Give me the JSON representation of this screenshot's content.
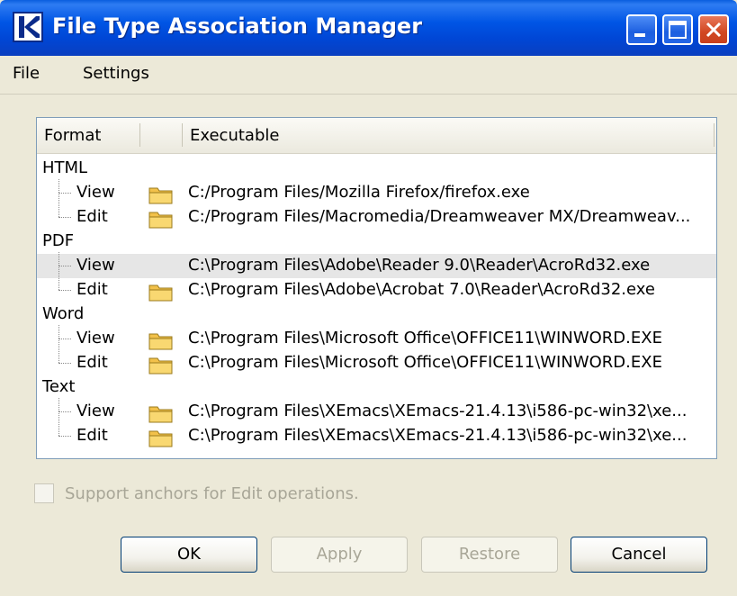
{
  "window": {
    "title": "File Type Association Manager"
  },
  "menu": {
    "items": [
      {
        "label": "File"
      },
      {
        "label": "Settings"
      }
    ]
  },
  "table": {
    "columns": [
      "Format",
      "",
      "Executable"
    ],
    "groups": [
      {
        "name": "HTML",
        "entries": [
          {
            "action": "View",
            "path": "C:/Program Files/Mozilla Firefox/firefox.exe",
            "has_icon": true
          },
          {
            "action": "Edit",
            "path": "C:/Program Files/Macromedia/Dreamweaver MX/Dreamweav...",
            "has_icon": true
          }
        ]
      },
      {
        "name": "PDF",
        "entries": [
          {
            "action": "View",
            "path": "C:\\Program Files\\Adobe\\Reader 9.0\\Reader\\AcroRd32.exe",
            "has_icon": false,
            "selected": true
          },
          {
            "action": "Edit",
            "path": "C:\\Program Files\\Adobe\\Acrobat 7.0\\Reader\\AcroRd32.exe",
            "has_icon": true
          }
        ]
      },
      {
        "name": "Word",
        "entries": [
          {
            "action": "View",
            "path": "C:\\Program Files\\Microsoft Office\\OFFICE11\\WINWORD.EXE",
            "has_icon": true
          },
          {
            "action": "Edit",
            "path": "C:\\Program Files\\Microsoft Office\\OFFICE11\\WINWORD.EXE",
            "has_icon": true
          }
        ]
      },
      {
        "name": "Text",
        "entries": [
          {
            "action": "View",
            "path": "C:\\Program Files\\XEmacs\\XEmacs-21.4.13\\i586-pc-win32\\xe...",
            "has_icon": true
          },
          {
            "action": "Edit",
            "path": "C:\\Program Files\\XEmacs\\XEmacs-21.4.13\\i586-pc-win32\\xe...",
            "has_icon": true
          }
        ]
      }
    ]
  },
  "options": {
    "anchor_label": "Support anchors for Edit operations.",
    "anchor_checked": false,
    "anchor_enabled": false
  },
  "buttons": {
    "ok": "OK",
    "apply": "Apply",
    "restore": "Restore",
    "cancel": "Cancel"
  },
  "icons": {
    "app": "app-logo-icon",
    "minimize": "minimize-icon",
    "maximize": "maximize-icon",
    "close": "close-icon",
    "folder": "folder-icon"
  },
  "colors": {
    "titlebar": "#0055e5",
    "close_button": "#d14721",
    "selection": "#e6e6e6",
    "folder": "#f2c14a"
  }
}
